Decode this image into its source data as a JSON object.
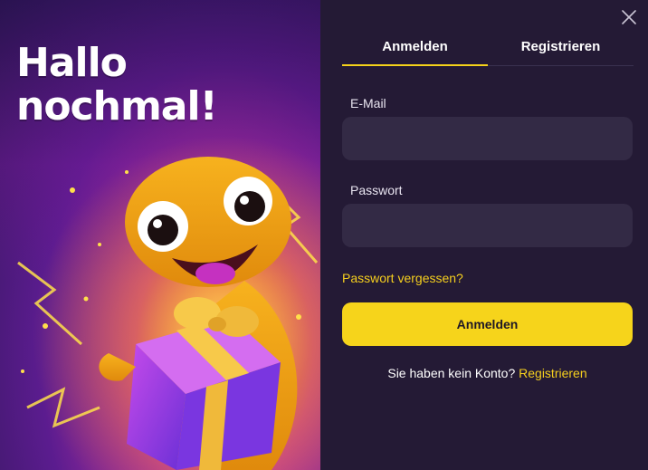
{
  "promo": {
    "title_line1": "Hallo",
    "title_line2": "nochmal!"
  },
  "tabs": [
    {
      "label": "Anmelden",
      "active": true
    },
    {
      "label": "Registrieren",
      "active": false
    }
  ],
  "form": {
    "email_label": "E-Mail",
    "email_value": "",
    "password_label": "Passwort",
    "password_value": "",
    "forgot_password": "Passwort vergessen?",
    "submit_label": "Anmelden",
    "no_account_text": "Sie haben kein Konto?",
    "register_link": "Registrieren"
  },
  "icons": {
    "close": "close-icon"
  },
  "colors": {
    "background": "#241a35",
    "input_bg": "#332a45",
    "accent": "#f6d41b",
    "link": "#f5cf1e"
  }
}
